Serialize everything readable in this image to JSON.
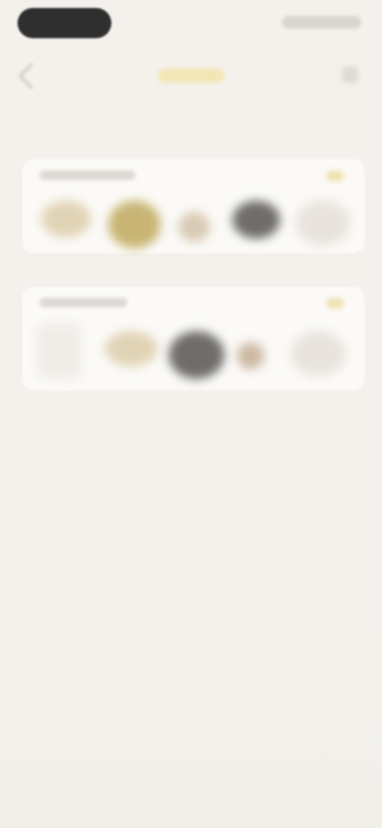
{
  "status_bar": {
    "pill_color": "#2f2f2f"
  },
  "header": {
    "logo_color": "#f2e6b4"
  },
  "page": {
    "title": "",
    "background_color": "#f4f1ec"
  },
  "cards": [
    {
      "label": "",
      "items": [
        {
          "icon": "tan-object-icon",
          "color": "#e1d3b5"
        },
        {
          "icon": "gold-object-icon",
          "color": "#c8b574"
        },
        {
          "icon": "beige-object-icon",
          "color": "#d9cbb5"
        },
        {
          "icon": "dark-object-icon",
          "color": "#6f6d6a"
        },
        {
          "icon": "light-object-icon",
          "color": "#e8e3dc"
        }
      ]
    },
    {
      "label": "",
      "items": [
        {
          "icon": "light-panel-icon",
          "color": "#f0ede8"
        },
        {
          "icon": "tan-object-icon",
          "color": "#e1d3b5"
        },
        {
          "icon": "dark-object-icon",
          "color": "#6f6d6a"
        },
        {
          "icon": "brown-object-icon",
          "color": "#cdb9a3"
        },
        {
          "icon": "light-object-icon",
          "color": "#e8e3dc"
        }
      ]
    }
  ]
}
